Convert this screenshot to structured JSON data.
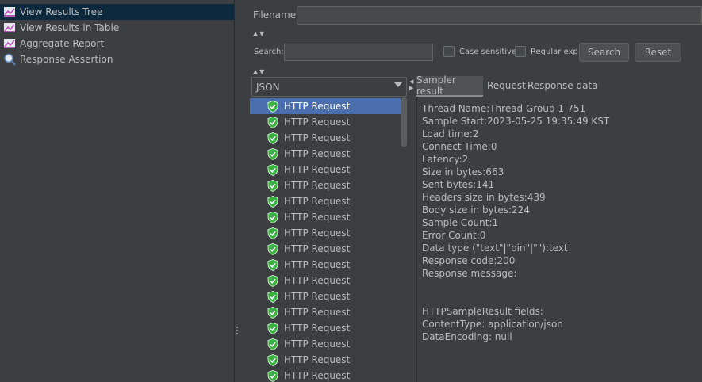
{
  "tree": {
    "items": [
      {
        "label": "View Results Tree",
        "icon": "graph-icon",
        "selected": true
      },
      {
        "label": "View Results in Table",
        "icon": "graph-icon",
        "selected": false
      },
      {
        "label": "Aggregate Report",
        "icon": "graph-icon",
        "selected": false
      },
      {
        "label": "Response Assertion",
        "icon": "magnifier-icon",
        "selected": false
      }
    ]
  },
  "filename": {
    "label": "Filename",
    "value": ""
  },
  "search": {
    "label": "Search:",
    "value": "",
    "case_sensitive_label": "Case sensitive",
    "regular_exp_label": "Regular exp.",
    "search_button": "Search",
    "reset_button": "Reset"
  },
  "renderer": {
    "selected": "JSON"
  },
  "samples": {
    "label": "HTTP Request",
    "count": 18,
    "selected_index": 0
  },
  "tabs": [
    {
      "label": "Sampler result",
      "active": true
    },
    {
      "label": "Request",
      "active": false
    },
    {
      "label": "Response data",
      "active": false
    }
  ],
  "details": {
    "lines": [
      "Thread Name:Thread Group 1-751",
      "Sample Start:2023-05-25 19:35:49 KST",
      "Load time:2",
      "Connect Time:0",
      "Latency:2",
      "Size in bytes:663",
      "Sent bytes:141",
      "Headers size in bytes:439",
      "Body size in bytes:224",
      "Sample Count:1",
      "Error Count:0",
      "Data type (\"text\"|\"bin\"|\"\"):text",
      "Response code:200",
      "Response message:",
      "",
      "",
      "HTTPSampleResult fields:",
      "ContentType: application/json",
      "DataEncoding: null"
    ]
  },
  "colors": {
    "background": "#3c3f41",
    "selection_tree": "#0d293e",
    "selection_list": "#4b6eaf",
    "text": "#bbbbbb",
    "success_icon": "#3bb143"
  }
}
